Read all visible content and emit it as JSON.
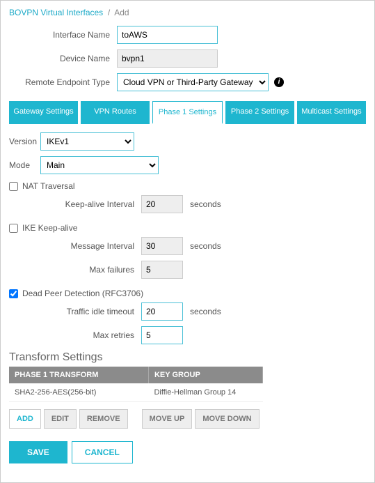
{
  "breadcrumb": {
    "root": "BOVPN Virtual Interfaces",
    "current": "Add"
  },
  "form": {
    "interfaceName": {
      "label": "Interface Name",
      "value": "toAWS"
    },
    "deviceName": {
      "label": "Device Name",
      "value": "bvpn1"
    },
    "remoteEndpoint": {
      "label": "Remote Endpoint Type",
      "value": "Cloud VPN or Third-Party Gateway"
    }
  },
  "tabs": {
    "gateway": "Gateway Settings",
    "vpnroutes": "VPN Routes",
    "phase1": "Phase 1 Settings",
    "phase2": "Phase 2 Settings",
    "multicast": "Multicast Settings"
  },
  "phase1": {
    "version": {
      "label": "Version",
      "value": "IKEv1"
    },
    "mode": {
      "label": "Mode",
      "value": "Main"
    },
    "nat": {
      "label": "NAT Traversal",
      "checked": false,
      "keepalive": {
        "label": "Keep-alive Interval",
        "value": "20",
        "unit": "seconds"
      }
    },
    "ike": {
      "label": "IKE Keep-alive",
      "checked": false,
      "msgInterval": {
        "label": "Message Interval",
        "value": "30",
        "unit": "seconds"
      },
      "maxFail": {
        "label": "Max failures",
        "value": "5"
      }
    },
    "dpd": {
      "label": "Dead Peer Detection (RFC3706)",
      "checked": true,
      "idle": {
        "label": "Traffic idle timeout",
        "value": "20",
        "unit": "seconds"
      },
      "retries": {
        "label": "Max retries",
        "value": "5"
      }
    }
  },
  "transform": {
    "title": "Transform Settings",
    "headers": {
      "col1": "Phase 1 Transform",
      "col2": "Key Group"
    },
    "row": {
      "col1": "SHA2-256-AES(256-bit)",
      "col2": "Diffie-Hellman Group 14"
    }
  },
  "buttons": {
    "add": "ADD",
    "edit": "EDIT",
    "remove": "REMOVE",
    "moveup": "MOVE UP",
    "movedown": "MOVE DOWN",
    "save": "SAVE",
    "cancel": "CANCEL"
  }
}
